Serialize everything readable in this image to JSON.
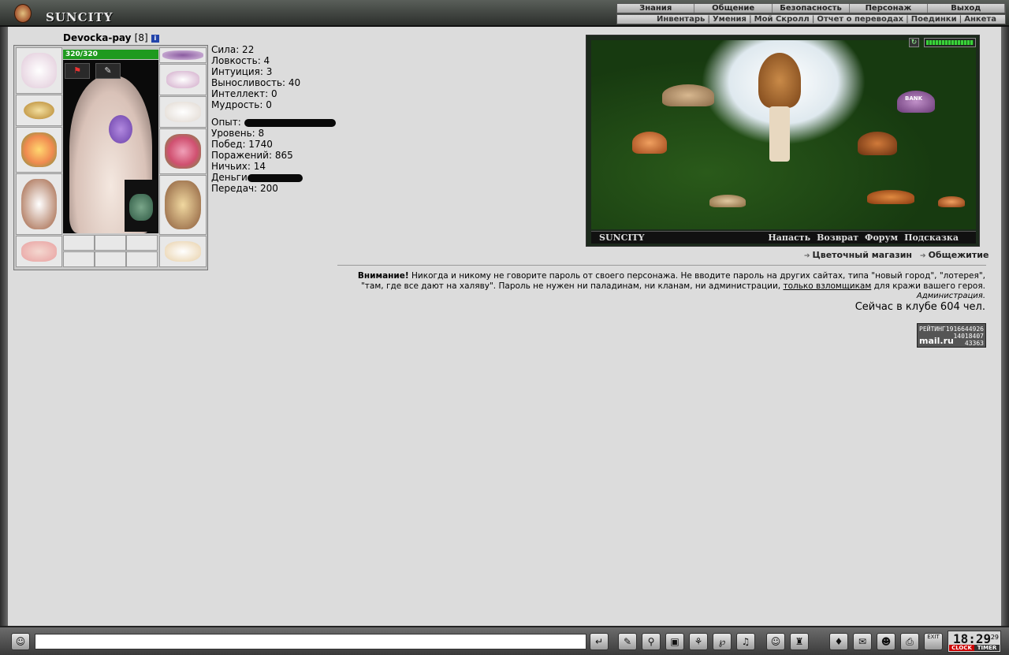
{
  "header": {
    "logo_text": "SUNCITY",
    "nav": [
      "Знания",
      "Общение",
      "Безопасность",
      "Персонаж",
      "Выход"
    ],
    "subnav": [
      "Инвентарь",
      "Умения",
      "Мой Скролл",
      "Отчет о переводах",
      "Поединки",
      "Анкета"
    ]
  },
  "character": {
    "name": "Devocka-pay",
    "level": "[8]",
    "info_icon": "i",
    "hp": "320/320",
    "hp_fraction": 1.0
  },
  "stats": {
    "strength": "Сила: 22",
    "agility": "Ловкость: 4",
    "intuition": "Интуиция: 3",
    "endurance": "Выносливость: 40",
    "intellect": "Интеллект: 0",
    "wisdom": "Мудрость: 0",
    "experience": "Опыт:",
    "level": "Уровень: 8",
    "wins": "Побед: 1740",
    "losses": "Поражений: 865",
    "draws": "Ничьих: 14",
    "money": "Деньги",
    "transfers": "Передач: 200"
  },
  "scene": {
    "brand": "SUNCITY",
    "links": [
      "Напасть",
      "Возврат",
      "Форум",
      "Подсказка"
    ],
    "bank_label": "BANK"
  },
  "scene_links": {
    "flower_shop": "Цветочный магазин",
    "dorm": "Общежитие"
  },
  "warning": {
    "bold": "Внимание!",
    "text1": " Никогда и никому не говорите пароль от своего персонажа. Не вводите пароль на других сайтах, типа \"новый город\", \"лотерея\", \"там, где все дают на халяву\". Пароль не нужен ни паладинам, ни кланам, ни администрации, ",
    "link": "только взломщикам",
    "text2": " для кражи вашего героя.",
    "signature": "Администрация.",
    "online": "Сейчас в клубе 604 чел."
  },
  "counter": {
    "label": "РЕЙТИНГ",
    "brand": "mail.ru",
    "n1": "1916644926",
    "n2": "14018407",
    "n3": "43363"
  },
  "bottom": {
    "clock": "18:29",
    "seconds": "29",
    "clock_btn": "CLOCK",
    "timer_btn": "TIMER",
    "exit_label": "EXIT"
  }
}
